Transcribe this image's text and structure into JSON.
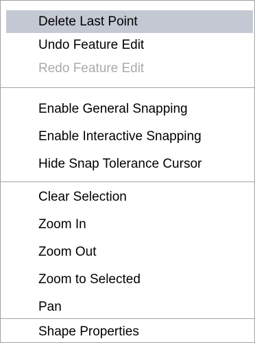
{
  "context_menu": {
    "groups": [
      {
        "items": [
          {
            "label": "Delete Last Point",
            "highlighted": true,
            "enabled": true
          },
          {
            "label": "Undo Feature Edit",
            "highlighted": false,
            "enabled": true
          },
          {
            "label": "Redo Feature Edit",
            "highlighted": false,
            "enabled": false
          }
        ]
      },
      {
        "items": [
          {
            "label": "Enable General Snapping",
            "highlighted": false,
            "enabled": true
          },
          {
            "label": "Enable Interactive Snapping",
            "highlighted": false,
            "enabled": true
          },
          {
            "label": "Hide Snap Tolerance Cursor",
            "highlighted": false,
            "enabled": true
          }
        ]
      },
      {
        "items": [
          {
            "label": "Clear Selection",
            "highlighted": false,
            "enabled": true
          },
          {
            "label": "Zoom In",
            "highlighted": false,
            "enabled": true
          },
          {
            "label": "Zoom Out",
            "highlighted": false,
            "enabled": true
          },
          {
            "label": "Zoom to Selected",
            "highlighted": false,
            "enabled": true
          },
          {
            "label": "Pan",
            "highlighted": false,
            "enabled": true
          }
        ]
      },
      {
        "items": [
          {
            "label": "Shape Properties",
            "highlighted": false,
            "enabled": true
          }
        ]
      }
    ],
    "colors": {
      "highlight": "#c3c8d3",
      "disabled_text": "#aaaaaa",
      "separator": "#a3a3a3",
      "border": "#a0a0a0"
    }
  }
}
